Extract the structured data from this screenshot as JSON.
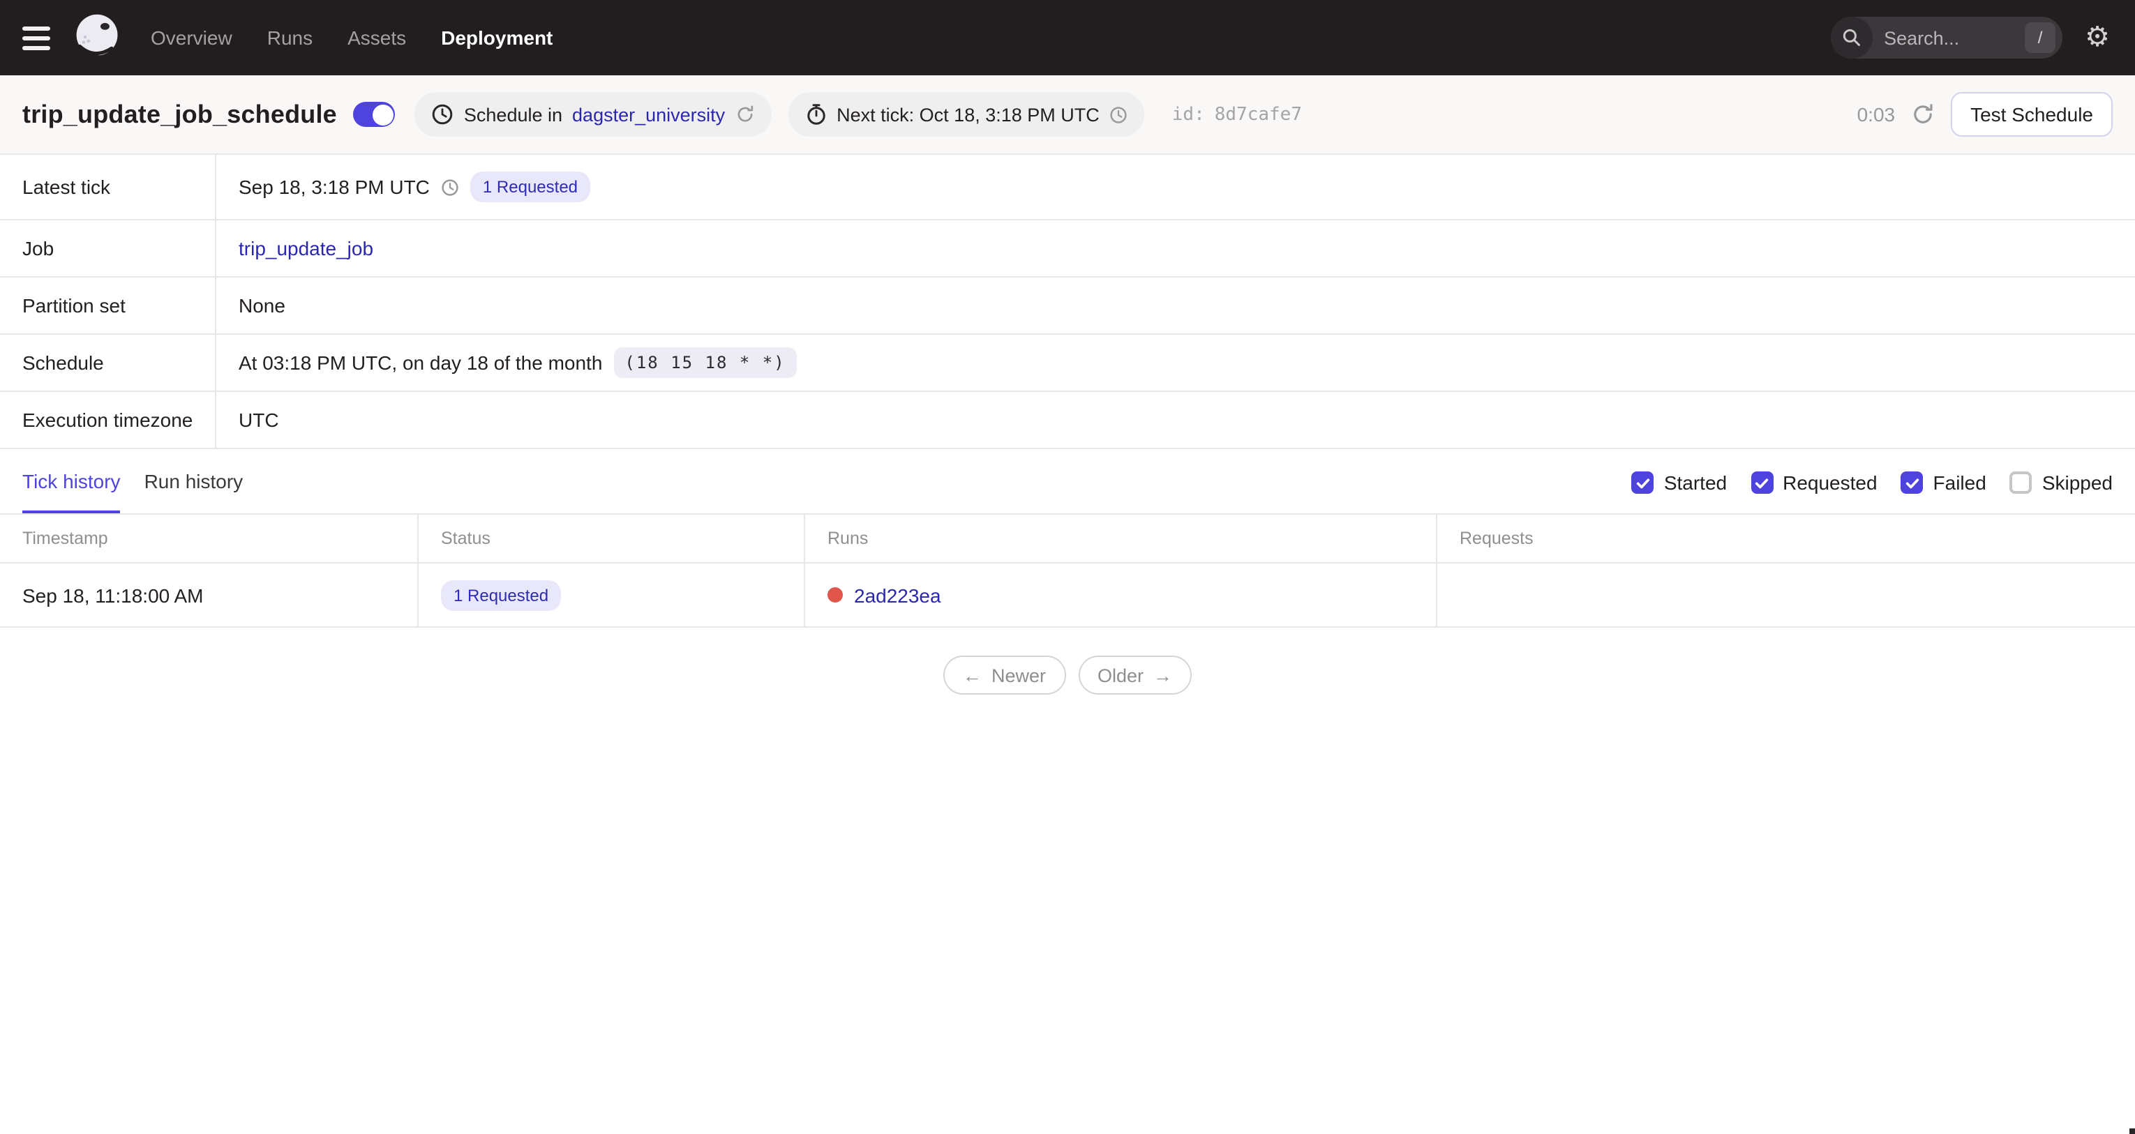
{
  "colors": {
    "accent": "#4F43DD",
    "link": "#2B28AE",
    "badge_bg": "#E9E8FB",
    "badge_text": "#2F2CB4",
    "failure": "#E0564A",
    "nav_bg": "#221E20",
    "header_bg": "#F9F8F7",
    "border": "#E8E7E8"
  },
  "nav": {
    "items": [
      {
        "label": "Overview",
        "active": false
      },
      {
        "label": "Runs",
        "active": false
      },
      {
        "label": "Assets",
        "active": false
      },
      {
        "label": "Deployment",
        "active": true
      }
    ],
    "search": {
      "placeholder": "Search...",
      "shortcut": "/"
    }
  },
  "header": {
    "title": "trip_update_job_schedule",
    "toggle_on": true,
    "schedule_pill": {
      "prefix": "Schedule in",
      "link": "dagster_university"
    },
    "next_tick_pill": {
      "text": "Next tick: Oct 18, 3:18 PM UTC"
    },
    "id_label": "id:",
    "id_value": "8d7cafe7",
    "countdown": "0:03",
    "test_button": "Test Schedule"
  },
  "details": {
    "rows": {
      "latest_tick": {
        "label": "Latest tick",
        "value": "Sep 18, 3:18 PM UTC",
        "badge": "1 Requested"
      },
      "job": {
        "label": "Job",
        "link": "trip_update_job"
      },
      "partition_set": {
        "label": "Partition set",
        "value": "None"
      },
      "schedule": {
        "label": "Schedule",
        "value": "At 03:18 PM UTC, on day 18 of the month",
        "cron": "(18 15 18 * *)"
      },
      "execution_timezone": {
        "label": "Execution timezone",
        "value": "UTC"
      }
    }
  },
  "tabs": [
    {
      "label": "Tick history",
      "active": true
    },
    {
      "label": "Run history",
      "active": false
    }
  ],
  "filters": [
    {
      "label": "Started",
      "checked": true
    },
    {
      "label": "Requested",
      "checked": true
    },
    {
      "label": "Failed",
      "checked": true
    },
    {
      "label": "Skipped",
      "checked": false
    }
  ],
  "tick_table": {
    "columns": [
      "Timestamp",
      "Status",
      "Runs",
      "Requests"
    ],
    "rows": [
      {
        "timestamp": "Sep 18, 11:18:00 AM",
        "status_badge": "1 Requested",
        "run_id": "2ad223ea",
        "requests": ""
      }
    ]
  },
  "pagination": {
    "newer_arrow": "←",
    "newer": "Newer",
    "older": "Older",
    "older_arrow": "→"
  }
}
